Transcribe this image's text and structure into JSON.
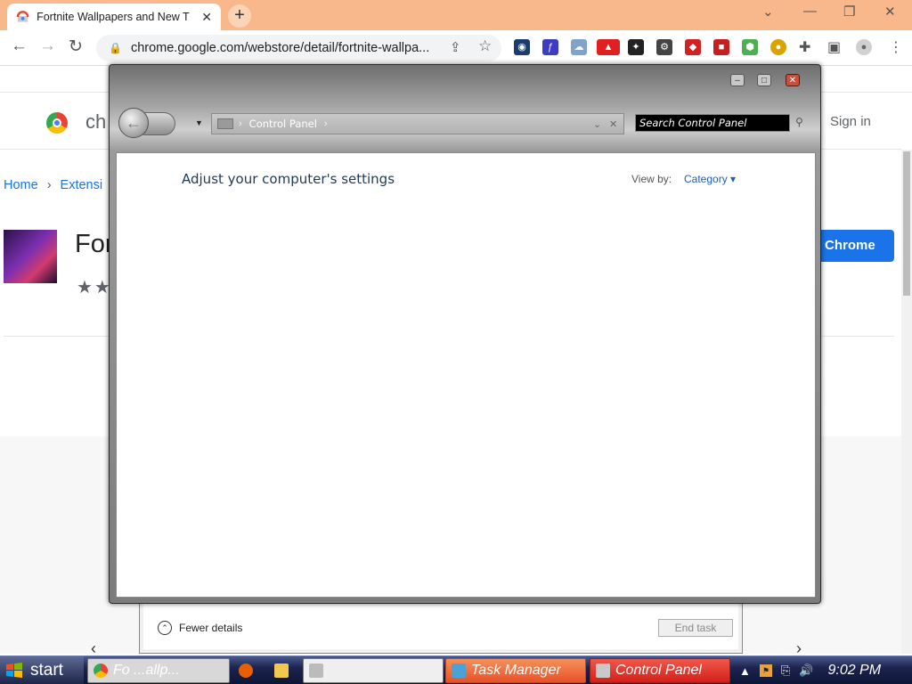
{
  "browser": {
    "tab_title": "Fortnite Wallpapers and New T",
    "tab_close": "✕",
    "new_tab": "+",
    "url": "chrome.google.com/webstore/detail/fortnite-wallpa...",
    "window_controls": {
      "minimize": "—",
      "restore": "❐",
      "close": "✕",
      "chevron": "⌄"
    }
  },
  "store": {
    "brand": "ch",
    "signin": "Sign in",
    "breadcrumbs": [
      "Home",
      "Extensi"
    ],
    "app_title": "For",
    "rating_stars": "★★",
    "add_button": "Chrome"
  },
  "control_panel": {
    "title_buttons": {
      "minimize": "–",
      "maximize": "□",
      "close": "✕"
    },
    "address": {
      "location": "Control Panel",
      "sep": "›"
    },
    "search_placeholder": "Search Control Panel",
    "heading": "Adjust your computer's settings",
    "view_by_label": "View by:",
    "view_by_value": "Category ▾"
  },
  "task_manager": {
    "fewer_details": "Fewer details",
    "end_task": "End task"
  },
  "taskbar": {
    "start": "start",
    "items": [
      {
        "label": "Fo   ...allp...",
        "active": false
      },
      {
        "label": "",
        "active": false
      },
      {
        "label": "Task Manager",
        "active": true
      },
      {
        "label": "Control Panel",
        "active": true
      }
    ],
    "clock": "9:02 PM"
  }
}
